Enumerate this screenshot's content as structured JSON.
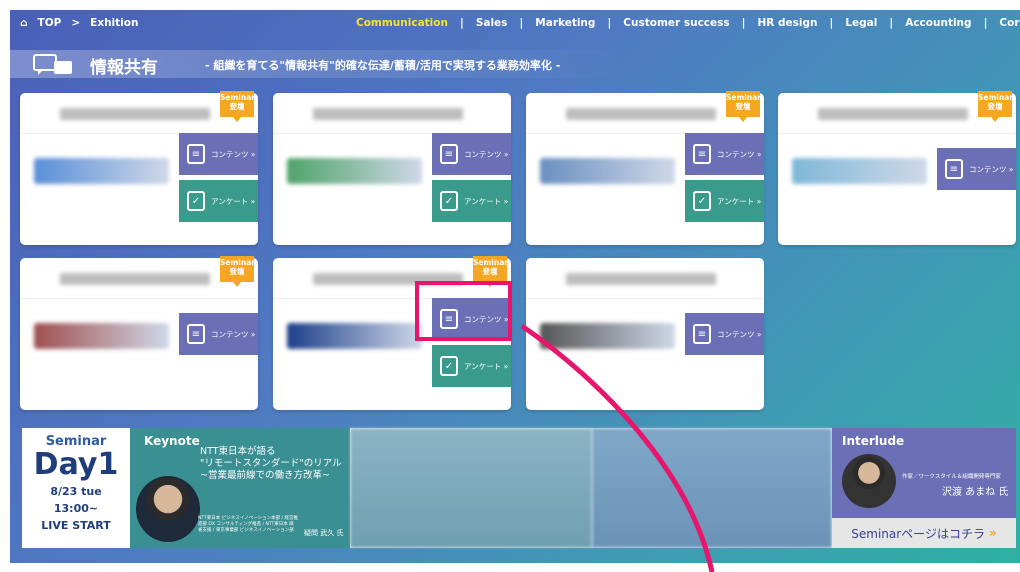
{
  "nav": {
    "home_icon": "home-icon",
    "home": "TOP",
    "separator": ">",
    "exhibition": "Exhition",
    "categories": [
      "Communication",
      "Sales",
      "Marketing",
      "Customer success",
      "HR design",
      "Legal",
      "Accounting",
      "Corporate governance"
    ],
    "active_category": "Communication",
    "divider": "|"
  },
  "header": {
    "title": "情報共有",
    "subtitle": "- 組織を育てる\"情報共有\"的確な伝達/蓄積/活用で実現する業務効率化 -"
  },
  "labels": {
    "badge": "Seminar\n登壇",
    "content": "コンテンツ »",
    "survey": "アンケート »"
  },
  "cards": [
    {
      "badge": true,
      "survey": true,
      "logo_color": "#5a8fd8"
    },
    {
      "badge": false,
      "survey": true,
      "logo_color": "#4fa36a"
    },
    {
      "badge": true,
      "survey": true,
      "logo_color": "#6a8fc0"
    },
    {
      "badge": true,
      "survey": false,
      "logo_color": "#7fb8d8"
    },
    {
      "badge": true,
      "survey": false,
      "logo_color": "#a05050"
    },
    {
      "badge": true,
      "survey": true,
      "logo_color": "#1e3f8a"
    },
    {
      "badge": false,
      "survey": false,
      "logo_color": "#555555"
    }
  ],
  "banner": {
    "seminar": "Seminar",
    "day": "Day1",
    "date": "8/23 tue",
    "time": "13:00~",
    "live": "LIVE START",
    "keynote_label": "Keynote",
    "keynote_title_1": "NTT東日本が語る",
    "keynote_title_2": "\"リモートスタンダード\"のリアル",
    "keynote_title_3": "~営業最前線での働き方改革~",
    "keynote_affil": "NTT東日本 ビジネスイノベーション本部 / 経営推進部 DX コンサルティング推進 / NTT東日本 麻雀支援 / 東京事業部 ビジネスイノベーション部",
    "keynote_name": "疑問 武久 氏",
    "interlude_label": "Interlude",
    "interlude_role": "作家／ワークスタイル＆組織開発専門家",
    "interlude_name": "沢渡 あまね 氏",
    "cta": "Seminarページはコチラ",
    "cta_chevron": "»"
  },
  "colors": {
    "accent": "#f5e52a",
    "badge": "#f5a623",
    "content_button": "#6b6fb5",
    "survey_button": "#3a9a8c",
    "highlight": "#e8156d"
  }
}
